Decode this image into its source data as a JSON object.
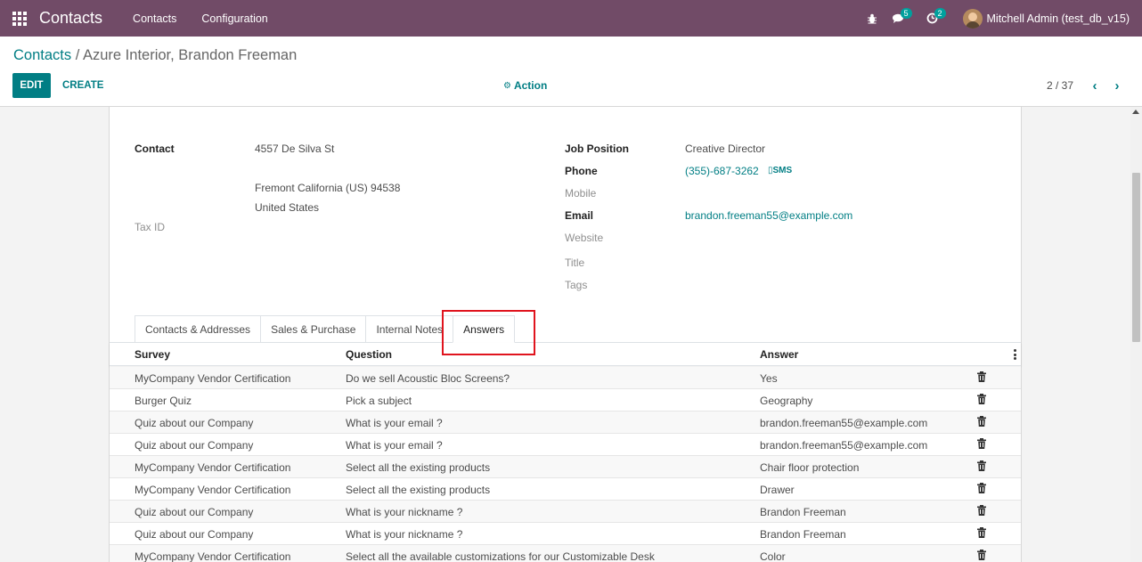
{
  "navbar": {
    "app_name": "Contacts",
    "menus": [
      "Contacts",
      "Configuration"
    ],
    "messages_count": "5",
    "activities_count": "2",
    "user": "Mitchell Admin (test_db_v15)"
  },
  "control_panel": {
    "breadcrumb_root": "Contacts",
    "breadcrumb_sep": "/",
    "breadcrumb_current": "Azure Interior, Brandon Freeman",
    "edit_label": "EDIT",
    "create_label": "CREATE",
    "action_label": "Action",
    "pager_text": "2 / 37"
  },
  "form": {
    "contact_label": "Contact",
    "address_street": "4557 De Silva St",
    "address_city_line": "Fremont  California (US)  94538",
    "address_country": "United States",
    "tax_id_label": "Tax ID",
    "job_position_label": "Job Position",
    "job_position_value": "Creative Director",
    "phone_label": "Phone",
    "phone_value": "(355)-687-3262",
    "sms_label": "SMS",
    "mobile_label": "Mobile",
    "email_label": "Email",
    "email_value": "brandon.freeman55@example.com",
    "website_label": "Website",
    "title_label": "Title",
    "tags_label": "Tags"
  },
  "tabs": [
    {
      "label": "Contacts & Addresses"
    },
    {
      "label": "Sales & Purchase"
    },
    {
      "label": "Internal Notes"
    },
    {
      "label": "Answers"
    }
  ],
  "table": {
    "headers": [
      "Survey",
      "Question",
      "Answer"
    ],
    "rows": [
      {
        "survey": "MyCompany Vendor Certification",
        "question": "Do we sell Acoustic Bloc Screens?",
        "answer": "Yes"
      },
      {
        "survey": "Burger Quiz",
        "question": "Pick a subject",
        "answer": "Geography"
      },
      {
        "survey": "Quiz about our Company",
        "question": "What is your email ?",
        "answer": "brandon.freeman55@example.com"
      },
      {
        "survey": "Quiz about our Company",
        "question": "What is your email ?",
        "answer": "brandon.freeman55@example.com"
      },
      {
        "survey": "MyCompany Vendor Certification",
        "question": "Select all the existing products",
        "answer": "Chair floor protection"
      },
      {
        "survey": "MyCompany Vendor Certification",
        "question": "Select all the existing products",
        "answer": "Drawer"
      },
      {
        "survey": "Quiz about our Company",
        "question": "What is your nickname ?",
        "answer": "Brandon Freeman"
      },
      {
        "survey": "Quiz about our Company",
        "question": "What is your nickname ?",
        "answer": "Brandon Freeman"
      },
      {
        "survey": "MyCompany Vendor Certification",
        "question": "Select all the available customizations for our Customizable Desk",
        "answer": "Color"
      }
    ]
  },
  "icons": {
    "apps": "apps-grid-icon",
    "bug": "bug-icon",
    "messages": "chat-icon",
    "activities": "clock-icon",
    "gear": "gear-icon",
    "trash": "trash-icon"
  },
  "colors": {
    "navbar": "#714b67",
    "accent": "#017e84",
    "badge": "#00a09d",
    "highlight": "#e0141e"
  }
}
